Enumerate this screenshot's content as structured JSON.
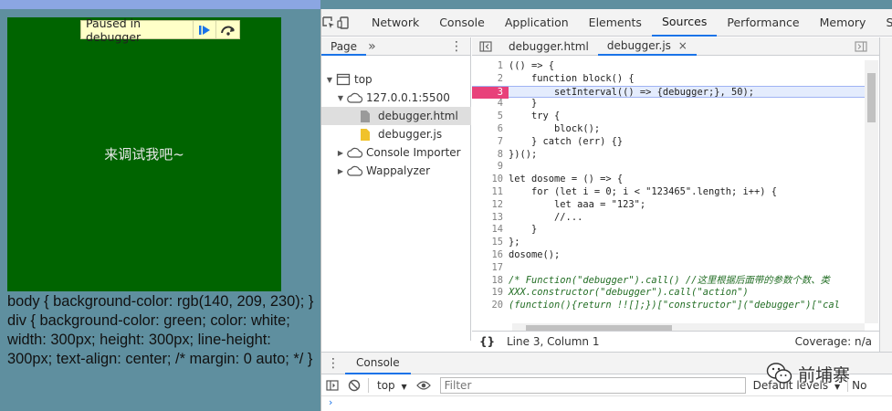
{
  "page": {
    "center_text": "来调试我吧~",
    "css_text": "body { background-color: rgb(140, 209, 230); } div { background-color: green; color: white; width: 300px; height: 300px; line-height: 300px; text-align: center; /* margin: 0 auto; */ }",
    "colors": {
      "green_box": "#006400",
      "page_bg": "#5f8f9f"
    }
  },
  "debugger_banner": {
    "label": "Paused in debugger",
    "resume_icon": "resume-icon",
    "step_over_icon": "step-over-icon"
  },
  "devtools": {
    "tabs": [
      "Network",
      "Console",
      "Application",
      "Elements",
      "Sources",
      "Performance",
      "Memory",
      "Securi"
    ],
    "active_tab": "Sources",
    "navigator": {
      "tab": "Page",
      "more": "»",
      "items": [
        {
          "label": "top",
          "icon": "frame-icon"
        },
        {
          "label": "127.0.0.1:5500",
          "icon": "cloud-icon"
        },
        {
          "label": "debugger.html",
          "icon": "file-icon"
        },
        {
          "label": "debugger.js",
          "icon": "js-file-icon"
        },
        {
          "label": "Console Importer",
          "icon": "cloud-icon"
        },
        {
          "label": "Wappalyzer",
          "icon": "cloud-icon"
        }
      ]
    },
    "editor": {
      "tabs": [
        {
          "label": "debugger.html"
        },
        {
          "label": "debugger.js",
          "close": "×"
        }
      ],
      "paused_line": 3,
      "lines": [
        "(() => {",
        "    function block() {",
        "        setInterval(() => {debugger;}, 50);",
        "    }",
        "    try {",
        "        block();",
        "    } catch (err) {}",
        "})();",
        "",
        "let dosome = () => {",
        "    for (let i = 0; i < \"123465\".length; i++) {",
        "        let aaa = \"123\";",
        "        //...",
        "    }",
        "};",
        "dosome();",
        "",
        "/* Function(\"debugger\").call() //这里根据后面带的参数个数、类",
        "XXX.constructor(\"debugger\").call(\"action\")",
        "(function(){return !![];})[\"constructor\"](\"debugger\")[\"cal"
      ],
      "line_numbers": [
        "1",
        "2",
        "3",
        "4",
        "5",
        "6",
        "7",
        "8",
        "9",
        "10",
        "11",
        "12",
        "13",
        "14",
        "15",
        "16",
        "17",
        "18",
        "19",
        "20"
      ]
    },
    "status": {
      "braces": "{}",
      "position": "Line 3, Column 1",
      "coverage": "Coverage: n/a"
    },
    "drawer": {
      "tab": "Console",
      "context": "top",
      "filter_placeholder": "Filter",
      "levels": "Default levels",
      "issues": "No"
    }
  },
  "watermark": {
    "text": "前埔寨",
    "logo_icon": "wechat-logo-icon"
  }
}
